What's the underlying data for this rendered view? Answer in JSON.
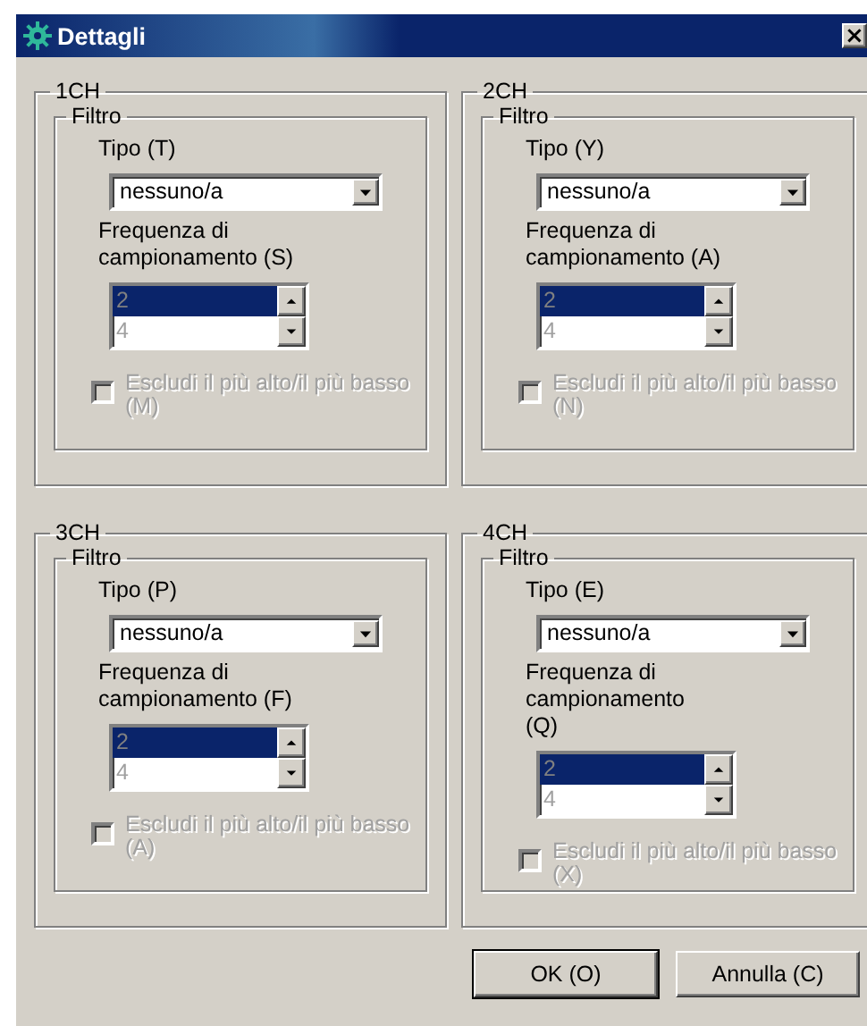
{
  "window": {
    "title": "Dettagli",
    "close": "×"
  },
  "channels": [
    {
      "name": "1CH",
      "filter_label": "Filtro",
      "type_label": "Tipo (T)",
      "type_value": "nessuno/a",
      "freq_label": "Frequenza di campionamento (S)",
      "freq_options": [
        {
          "label": "2",
          "selected": true
        },
        {
          "label": "4",
          "selected": false
        }
      ],
      "exclude_label": "Escludi il più alto/il più basso (M)",
      "exclude_checked": false,
      "exclude_disabled": true
    },
    {
      "name": "2CH",
      "filter_label": "Filtro",
      "type_label": "Tipo (Y)",
      "type_value": "nessuno/a",
      "freq_label": "Frequenza di campionamento (A)",
      "freq_options": [
        {
          "label": "2",
          "selected": true
        },
        {
          "label": "4",
          "selected": false
        }
      ],
      "exclude_label": "Escludi il più alto/il più basso (N)",
      "exclude_checked": false,
      "exclude_disabled": true
    },
    {
      "name": "3CH",
      "filter_label": "Filtro",
      "type_label": "Tipo (P)",
      "type_value": "nessuno/a",
      "freq_label": "Frequenza di campionamento (F)",
      "freq_options": [
        {
          "label": "2",
          "selected": true
        },
        {
          "label": "4",
          "selected": false
        }
      ],
      "exclude_label": "Escludi il più alto/il più basso (A)",
      "exclude_checked": false,
      "exclude_disabled": true
    },
    {
      "name": "4CH",
      "filter_label": "Filtro",
      "type_label": "Tipo (E)",
      "type_value": "nessuno/a",
      "freq_label": "Frequenza di campionamento (Q)",
      "freq_options": [
        {
          "label": "2",
          "selected": true
        },
        {
          "label": "4",
          "selected": false
        }
      ],
      "exclude_label": "Escludi il più alto/il più basso (X)",
      "exclude_checked": false,
      "exclude_disabled": true
    }
  ],
  "buttons": [
    {
      "label": "OK (O)",
      "default": true
    },
    {
      "label": "Annulla (C)",
      "default": false
    }
  ]
}
